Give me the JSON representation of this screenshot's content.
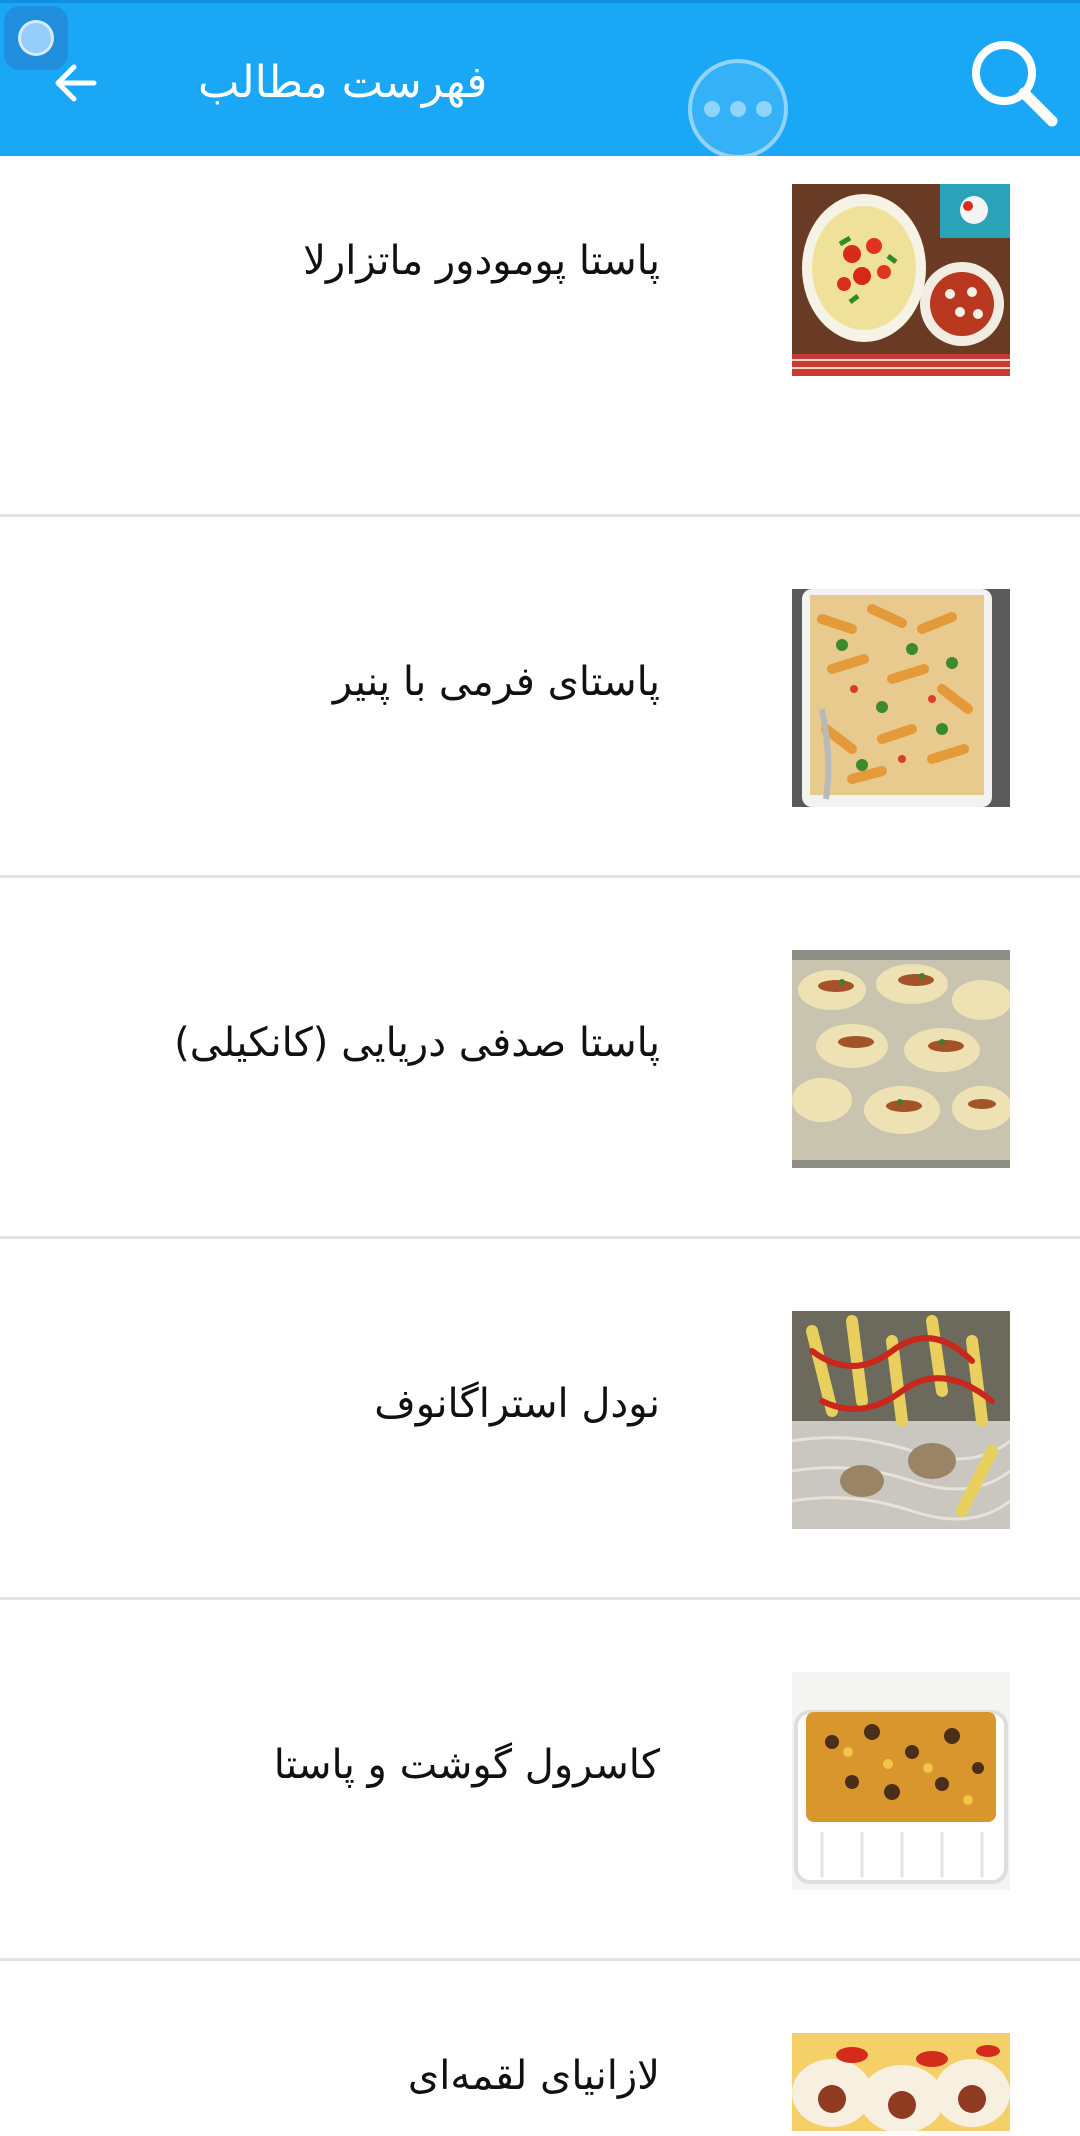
{
  "appbar": {
    "title": "فهرست مطالب",
    "back_icon": "arrow-left-icon",
    "more_icon": "more-dots-icon",
    "search_icon": "search-icon",
    "color": "#1aa7f6"
  },
  "items": [
    {
      "label": "پاستا پومودور ماتزارلا",
      "image": "pasta-pomodoro-image"
    },
    {
      "label": "پاستای فرمی با پنیر",
      "image": "baked-pasta-cheese-image"
    },
    {
      "label": "پاستا صدفی دریایی (کانکیلی)",
      "image": "stuffed-shells-image"
    },
    {
      "label": "نودل استراگانوف",
      "image": "noodle-stroganoff-image"
    },
    {
      "label": "کاسرول گوشت و پاستا",
      "image": "beef-pasta-casserole-image"
    },
    {
      "label": "لازانیای لقمه‌ای",
      "image": "lasagna-rolls-image"
    }
  ]
}
